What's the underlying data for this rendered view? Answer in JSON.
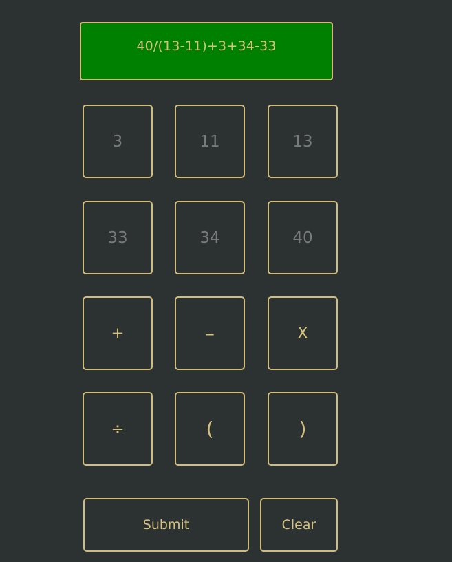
{
  "display": {
    "expression": "40/(13-11)+3+34-33"
  },
  "numbers": [
    "3",
    "11",
    "13",
    "33",
    "34",
    "40"
  ],
  "operators": [
    "+",
    "–",
    "X",
    "÷",
    "(",
    ")"
  ],
  "actions": {
    "submit_label": "Submit",
    "clear_label": "Clear"
  },
  "colors": {
    "background": "#2c3132",
    "display_bg": "#008000",
    "border": "#d0bd7c",
    "accent_text": "#d6c27e",
    "number_text": "#777b7b"
  }
}
